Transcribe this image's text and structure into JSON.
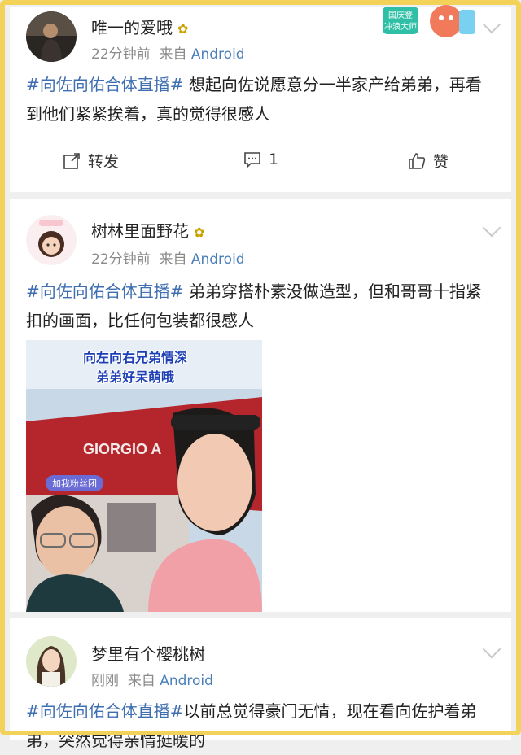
{
  "posts": [
    {
      "username": "唯一的爱哦",
      "time": "22分钟前",
      "from_label": "来自",
      "source": "Android",
      "hashtag": "#向佐向佑合体直播#",
      "text": " 想起向佐说愿意分一半家产给弟弟，再看到他们紧紧挨着，真的觉得很感人",
      "actions": {
        "repost": "转发",
        "comment": "1",
        "like": "赞"
      }
    },
    {
      "username": "树林里面野花",
      "time": "22分钟前",
      "from_label": "来自",
      "source": "Android",
      "hashtag": "#向佐向佑合体直播#",
      "text": " 弟弟穿搭朴素没做造型，但和哥哥十指紧扣的画面，比任何包装都很感人",
      "video": {
        "caption_line1": "向左向右兄弟情深",
        "caption_line2": "弟弟好呆萌哦",
        "store_sign": "GIORGIO A",
        "sticker": "加我粉丝团"
      }
    },
    {
      "username": "梦里有个樱桃树",
      "time": "刚刚",
      "from_label": "来自",
      "source": "Android",
      "hashtag": "#向佐向佑合体直播#",
      "text": "以前总觉得豪门无情，现在看向佐护着弟弟，突然觉得亲情挺暖的"
    }
  ],
  "promo": {
    "line1": "国庆登",
    "line2": "冲浪大师"
  },
  "colors": {
    "link": "#3f6fb0",
    "meta": "#8a8a8a",
    "frame": "#f3d25a"
  }
}
